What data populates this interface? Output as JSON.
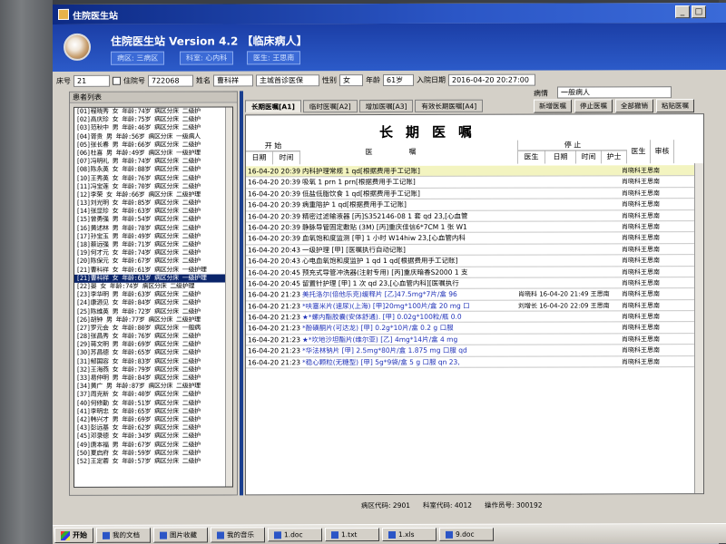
{
  "window": {
    "title": "住院医生站",
    "system_name": "住院医生站 Version 4.2 【临床病人】",
    "sub_labels": [
      "病区: 三病区",
      "科室: 心内科",
      "医生: 王思南"
    ],
    "window_buttons": [
      "_",
      "□"
    ]
  },
  "patient_bar": {
    "bed_label": "床号",
    "bed_value": "21",
    "checkbox_label": "住院号",
    "admission_no": "722068",
    "name_label": "姓名",
    "name_value": "曹科祥",
    "diagnosis": "主城首诊医保",
    "sex_label": "性别",
    "sex_value": "女",
    "age_label": "年龄",
    "age_value": "61岁",
    "admit_label": "入院日期",
    "admit_value": "2016-04-20 20:27:00"
  },
  "ward_select": {
    "label": "病情",
    "value": "一般病人"
  },
  "patient_list": {
    "title": "患者列表",
    "selected_index": 20,
    "rows": [
      "[01]程晓秀 女  年龄:74岁 病区分床 二级护",
      "[02]高庆珍 女  年龄:75岁 病区分床 二级护",
      "[03]范秋中 男  年龄:46岁 病区分床 二级护",
      "[04]胥贵 男  年龄:56岁 病区分床 一级病人",
      "[05]张长春 男  年龄:66岁 病区分床 二级护",
      "[06]杜喜 男  年龄:49岁 病区分床 一级护理",
      "[07]冯明礼 男  年龄:74岁 病区分床 二级护",
      "[08]陈永英 女  年龄:88岁 病区分床 二级护",
      "[10]王秀英 女  年龄:76岁 病区分床 二级护",
      "[11]冯宝莲 女  年龄:70岁 病区分床 二级护",
      "[12]李荣 女  年龄:66岁 病区分床 二级护理",
      "[13]刘光明 女  年龄:85岁 病区分床 二级护",
      "[14]张显珍 女  年龄:63岁 病区分床 二级护",
      "[15]曾勇强 男  年龄:54岁 病区分床 二级护",
      "[16]黄述林 男  年龄:78岁 病区分床 二级护",
      "[17]孙宝玉 男  年龄:49岁 病区分床 二级护",
      "[18]蔡远强 男  年龄:71岁 病区分床 二级护",
      "[19]何才元 女  年龄:74岁 病区分床 二级护",
      "[20]陈保元 女  年龄:67岁 病区分床 二级护",
      "[21]曹科祥 女  年龄:61岁 病区分床 一级护理",
      "[21]曹科祥 女  年龄:61岁 病区分床 一级护理",
      "[22]晏 女  年龄:74岁 病区分床 二级护理",
      "[23]李华明 男  年龄:63岁 病区分床 二级护",
      "[24]康源见 女  年龄:84岁 病区分床 二级护",
      "[25]陈维英 男  年龄:72岁 病区分床 二级护",
      "[26]胡钟 男  年龄:77岁 病区分床 二级护理",
      "[27]罗元会 女  年龄:80岁 病区分床 一般病",
      "[28]张昌秀 女  年龄:76岁 病区分床 二级护",
      "[29]蒋文明 男  年龄:69岁 病区分床 二级护",
      "[30]苏昌德 女  年龄:65岁 病区分床 二级护",
      "[31]郁国容 女  年龄:83岁 病区分床 二级护",
      "[32]王海燕 女  年龄:79岁 病区分床 二级护",
      "[33]易仲明 男  年龄:84岁 病区分床 二级护",
      "[34]黄广 男  年龄:87岁 病区分床 二级护理",
      "[37]周克新 女  年龄:40岁 病区分床 二级护",
      "[40]何修勤 女  年龄:51岁 病区分床 二级护",
      "[41]李明忠 女  年龄:65岁 病区分床 二级护",
      "[42]韩兴才 男  年龄:69岁 病区分床 二级护",
      "[43]彭远基 女  年龄:62岁 病区分床 二级护",
      "[45]邓录德 女  年龄:34岁 病区分床 二级护",
      "[49]唐本福 男  年龄:67岁 病区分床 二级护",
      "[50]夏启府 女  年龄:59岁 病区分床 二级护",
      "[52]王定蓉 女  年龄:57岁 病区分床 二级护"
    ]
  },
  "tabs": [
    "长期医嘱[A1]",
    "临时医嘱[A2]",
    "增加医嘱[A3]",
    "有效长期医嘱[A4]"
  ],
  "actions": [
    "新增医嘱",
    "停止医嘱",
    "全部撤销",
    "粘贴医嘱"
  ],
  "orders": {
    "title": "长期医嘱",
    "header_start": "开  始",
    "header_stop": "停  止",
    "col_date": "日期",
    "col_time": "时间",
    "col_content": "医嘱",
    "col_stop_doctor": "医生",
    "col_stop_date": "日期",
    "col_stop_time": "时间",
    "col_stop_nurse": "护士",
    "col_doctor": "医生",
    "col_review": "审核",
    "rows": [
      {
        "dt": "16-04-20 20:39",
        "text": "内科护理常规 1  qd[根据费用手工记账]",
        "stop": "",
        "doc": "肖晓科王思南",
        "hl": true,
        "blue": false
      },
      {
        "dt": "16-04-20 20:39",
        "text": "吸氧 1  prn 1  prn[根据费用手工记账]",
        "stop": "",
        "doc": "肖晓科王思南",
        "hl": false,
        "blue": false
      },
      {
        "dt": "16-04-20 20:39",
        "text": "低盐低脂饮食 1  qd[根据费用手工记账]",
        "stop": "",
        "doc": "肖晓科王思南",
        "hl": false,
        "blue": false
      },
      {
        "dt": "16-04-20 20:39",
        "text": "病重陪护 1  qd[根据费用手工记账]",
        "stop": "",
        "doc": "肖晓科王思南",
        "hl": false,
        "blue": false
      },
      {
        "dt": "16-04-20 20:39",
        "text": "精密过滤输液器 [丙]S352146-08 1 套  qd 23,[心血管",
        "stop": "",
        "doc": "肖晓科王思南",
        "hl": false,
        "blue": false
      },
      {
        "dt": "16-04-20 20:39",
        "text": "静脉导管固定敷贴 (3M) [丙]重庆佳信6*7CM 1 张  W1",
        "stop": "",
        "doc": "肖晓科王思南",
        "hl": false,
        "blue": false
      },
      {
        "dt": "16-04-20 20:39",
        "text": "血氧饱和度监测 [甲] 1 小时  W14hiw 23,[心血管内科",
        "stop": "",
        "doc": "肖晓科王思南",
        "hl": false,
        "blue": false
      },
      {
        "dt": "16-04-20 20:43",
        "text": "一级护理 [甲] [医嘱执行自动记账]",
        "stop": "",
        "doc": "肖晓科王思南",
        "hl": false,
        "blue": false
      },
      {
        "dt": "16-04-20 20:43",
        "text": "心电血氧饱和度监护 1  qd 1  qd[根据费用手工记账]",
        "stop": "",
        "doc": "肖晓科王思南",
        "hl": false,
        "blue": false
      },
      {
        "dt": "16-04-20 20:45",
        "text": "预充式导管冲洗器(注射专用) [丙]重庆暗香S2000 1 支",
        "stop": "",
        "doc": "肖晓科王思南",
        "hl": false,
        "blue": false
      },
      {
        "dt": "16-04-20 20:45",
        "text": "留置针护理 [甲] 1 次  qd 23,[心血管内科][医嘱执行",
        "stop": "",
        "doc": "肖晓科王思南",
        "hl": false,
        "blue": false
      },
      {
        "dt": "16-04-20 21:23",
        "text": "美托洛尔(倍他乐克)缓释片 [乙]47.5mg*7片/盒  96",
        "stop": "肖晓科 16-04-20 21:49 王思南",
        "doc": "肖晓科王思南",
        "hl": false,
        "blue": true
      },
      {
        "dt": "16-04-20 21:23",
        "text": "*呋塞米片(速尿)(上海) [甲]20mg*100片/盒 20 mg 口",
        "stop": "刘增长 16-04-20 22:09 王思南",
        "doc": "肖晓科王思南",
        "hl": false,
        "blue": true
      },
      {
        "dt": "16-04-20 21:23",
        "text": "★*螺内酯胶囊(安体舒通). [甲] 0.02g*100粒/瓶 0.0",
        "stop": "",
        "doc": "肖晓科王思南",
        "hl": false,
        "blue": true
      },
      {
        "dt": "16-04-20 21:23",
        "text": "*酚磺酮片(可达龙) [甲] 0.2g*10片/盒 0.2 g 口服",
        "stop": "",
        "doc": "肖晓科王思南",
        "hl": false,
        "blue": true
      },
      {
        "dt": "16-04-20 21:23",
        "text": "★*坎地沙坦酯片(维尔亚) [乙] 4mg*14片/盒 4 mg",
        "stop": "",
        "doc": "肖晓科王思南",
        "hl": false,
        "blue": true
      },
      {
        "dt": "16-04-20 21:23",
        "text": "*华法林钠片 [甲] 2.5mg*80片/盒 1.875 mg 口服 qd",
        "stop": "",
        "doc": "肖晓科王思南",
        "hl": false,
        "blue": true
      },
      {
        "dt": "16-04-20 21:23",
        "text": "*稳心颗粒(无糖型) [甲] 5g*9袋/盒 5 g 口服 qn 23,",
        "stop": "",
        "doc": "肖晓科王思南",
        "hl": false,
        "blue": true
      }
    ]
  },
  "status_bar": {
    "ward_code": "病区代码: 2901",
    "dept_code": "科室代码: 4012",
    "operator": "操作员号: 300192"
  },
  "taskbar": {
    "start": "开始",
    "items": [
      "我的文档",
      "图片收藏",
      "我的音乐",
      "1.doc",
      "1.txt",
      "1.xls",
      "9.doc"
    ]
  }
}
